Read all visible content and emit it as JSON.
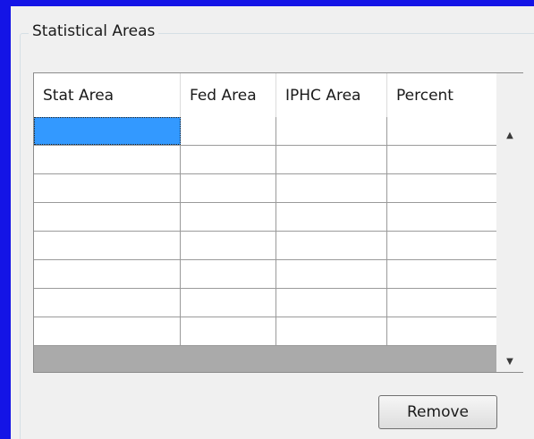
{
  "groupbox": {
    "title": "Statistical Areas"
  },
  "table": {
    "columns": [
      "Stat Area",
      "Fed Area",
      "IPHC Area",
      "Percent"
    ],
    "rows": [
      [
        "",
        "",
        "",
        ""
      ],
      [
        "",
        "",
        "",
        ""
      ],
      [
        "",
        "",
        "",
        ""
      ],
      [
        "",
        "",
        "",
        ""
      ],
      [
        "",
        "",
        "",
        ""
      ],
      [
        "",
        "",
        "",
        ""
      ],
      [
        "",
        "",
        "",
        ""
      ],
      [
        "",
        "",
        "",
        ""
      ]
    ],
    "selected_cell": {
      "row": 0,
      "column": 0
    }
  },
  "scrollbar": {
    "up_icon": "scroll-up-arrow",
    "down_icon": "scroll-down-arrow"
  },
  "buttons": {
    "remove_label": "Remove"
  },
  "colors": {
    "frame_accent": "#1414e6",
    "selection": "#3399ff"
  }
}
